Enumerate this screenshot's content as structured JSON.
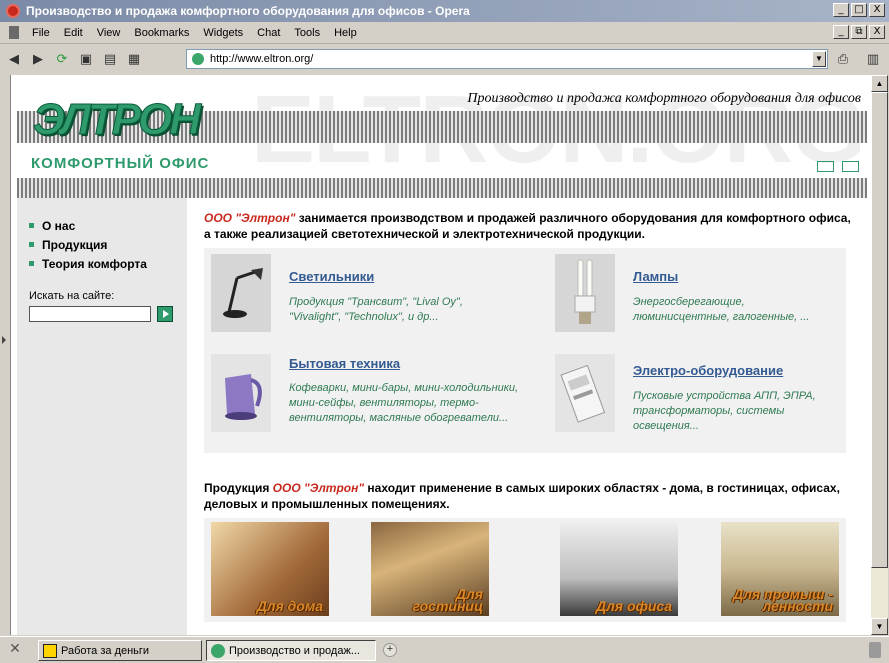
{
  "window": {
    "title": "Производство и продажа комфортного оборудования для офисов - Opera",
    "controls": [
      "_",
      "□",
      "X"
    ],
    "mdi_controls": [
      "_",
      "⧉",
      "X"
    ]
  },
  "menu": [
    "File",
    "Edit",
    "View",
    "Bookmarks",
    "Widgets",
    "Chat",
    "Tools",
    "Help"
  ],
  "toolbar": {
    "back_icon": "back-arrow-icon",
    "forward_icon": "forward-arrow-icon",
    "reload_icon": "reload-icon",
    "address_url": "http://www.eltron.org/"
  },
  "site": {
    "watermark": "ELTRON.ORG",
    "tagline": "Производство и продажа комфортного оборудования для офисов",
    "logo": "ЭЛТРОН",
    "slogan": "КОМФОРТНЫЙ ОФИС",
    "nav": [
      "О нас",
      "Продукция",
      "Теория комфорта"
    ],
    "search_label": "Искать на сайте:",
    "search_value": "",
    "intro_brand": "ООО \"Элтрон\"",
    "intro_text": " занимается производством и продажей различного оборудования для комфортного офиса, а также реализацией светотехнической и электротехнической продукции.",
    "products": [
      {
        "title": "Светильники",
        "desc": "Продукция \"Трансвит\", \"Lival Oy\", \"Vivalight\", \"Technolux\", и др..."
      },
      {
        "title": "Лампы",
        "desc": "Энергосберегающие, люминисцентные, галогенные, ..."
      },
      {
        "title": "Бытовая техника",
        "desc": "Кофеварки, мини-бары, мини-холодильники, мини-сейфы, вентиляторы, термо-вентиляторы, масляные обогреватели..."
      },
      {
        "title": "Электро-оборудование",
        "desc": "Пусковые устройства АПП, ЭПРА, трансформаторы, системы освещения..."
      }
    ],
    "usage_prefix": "Продукция ",
    "usage_brand": "ООО \"Элтрон\"",
    "usage_text": " находит применение в самых широких областях - дома, в гостиницах, офисах, деловых и промышленных помещениях.",
    "rooms": [
      "Для дома",
      "Для\nгостиниц",
      "Для офиса",
      "Для промыш -\nленности"
    ]
  },
  "taskbar": {
    "tasks": [
      "Работа за деньги",
      "Производство и продаж..."
    ]
  }
}
